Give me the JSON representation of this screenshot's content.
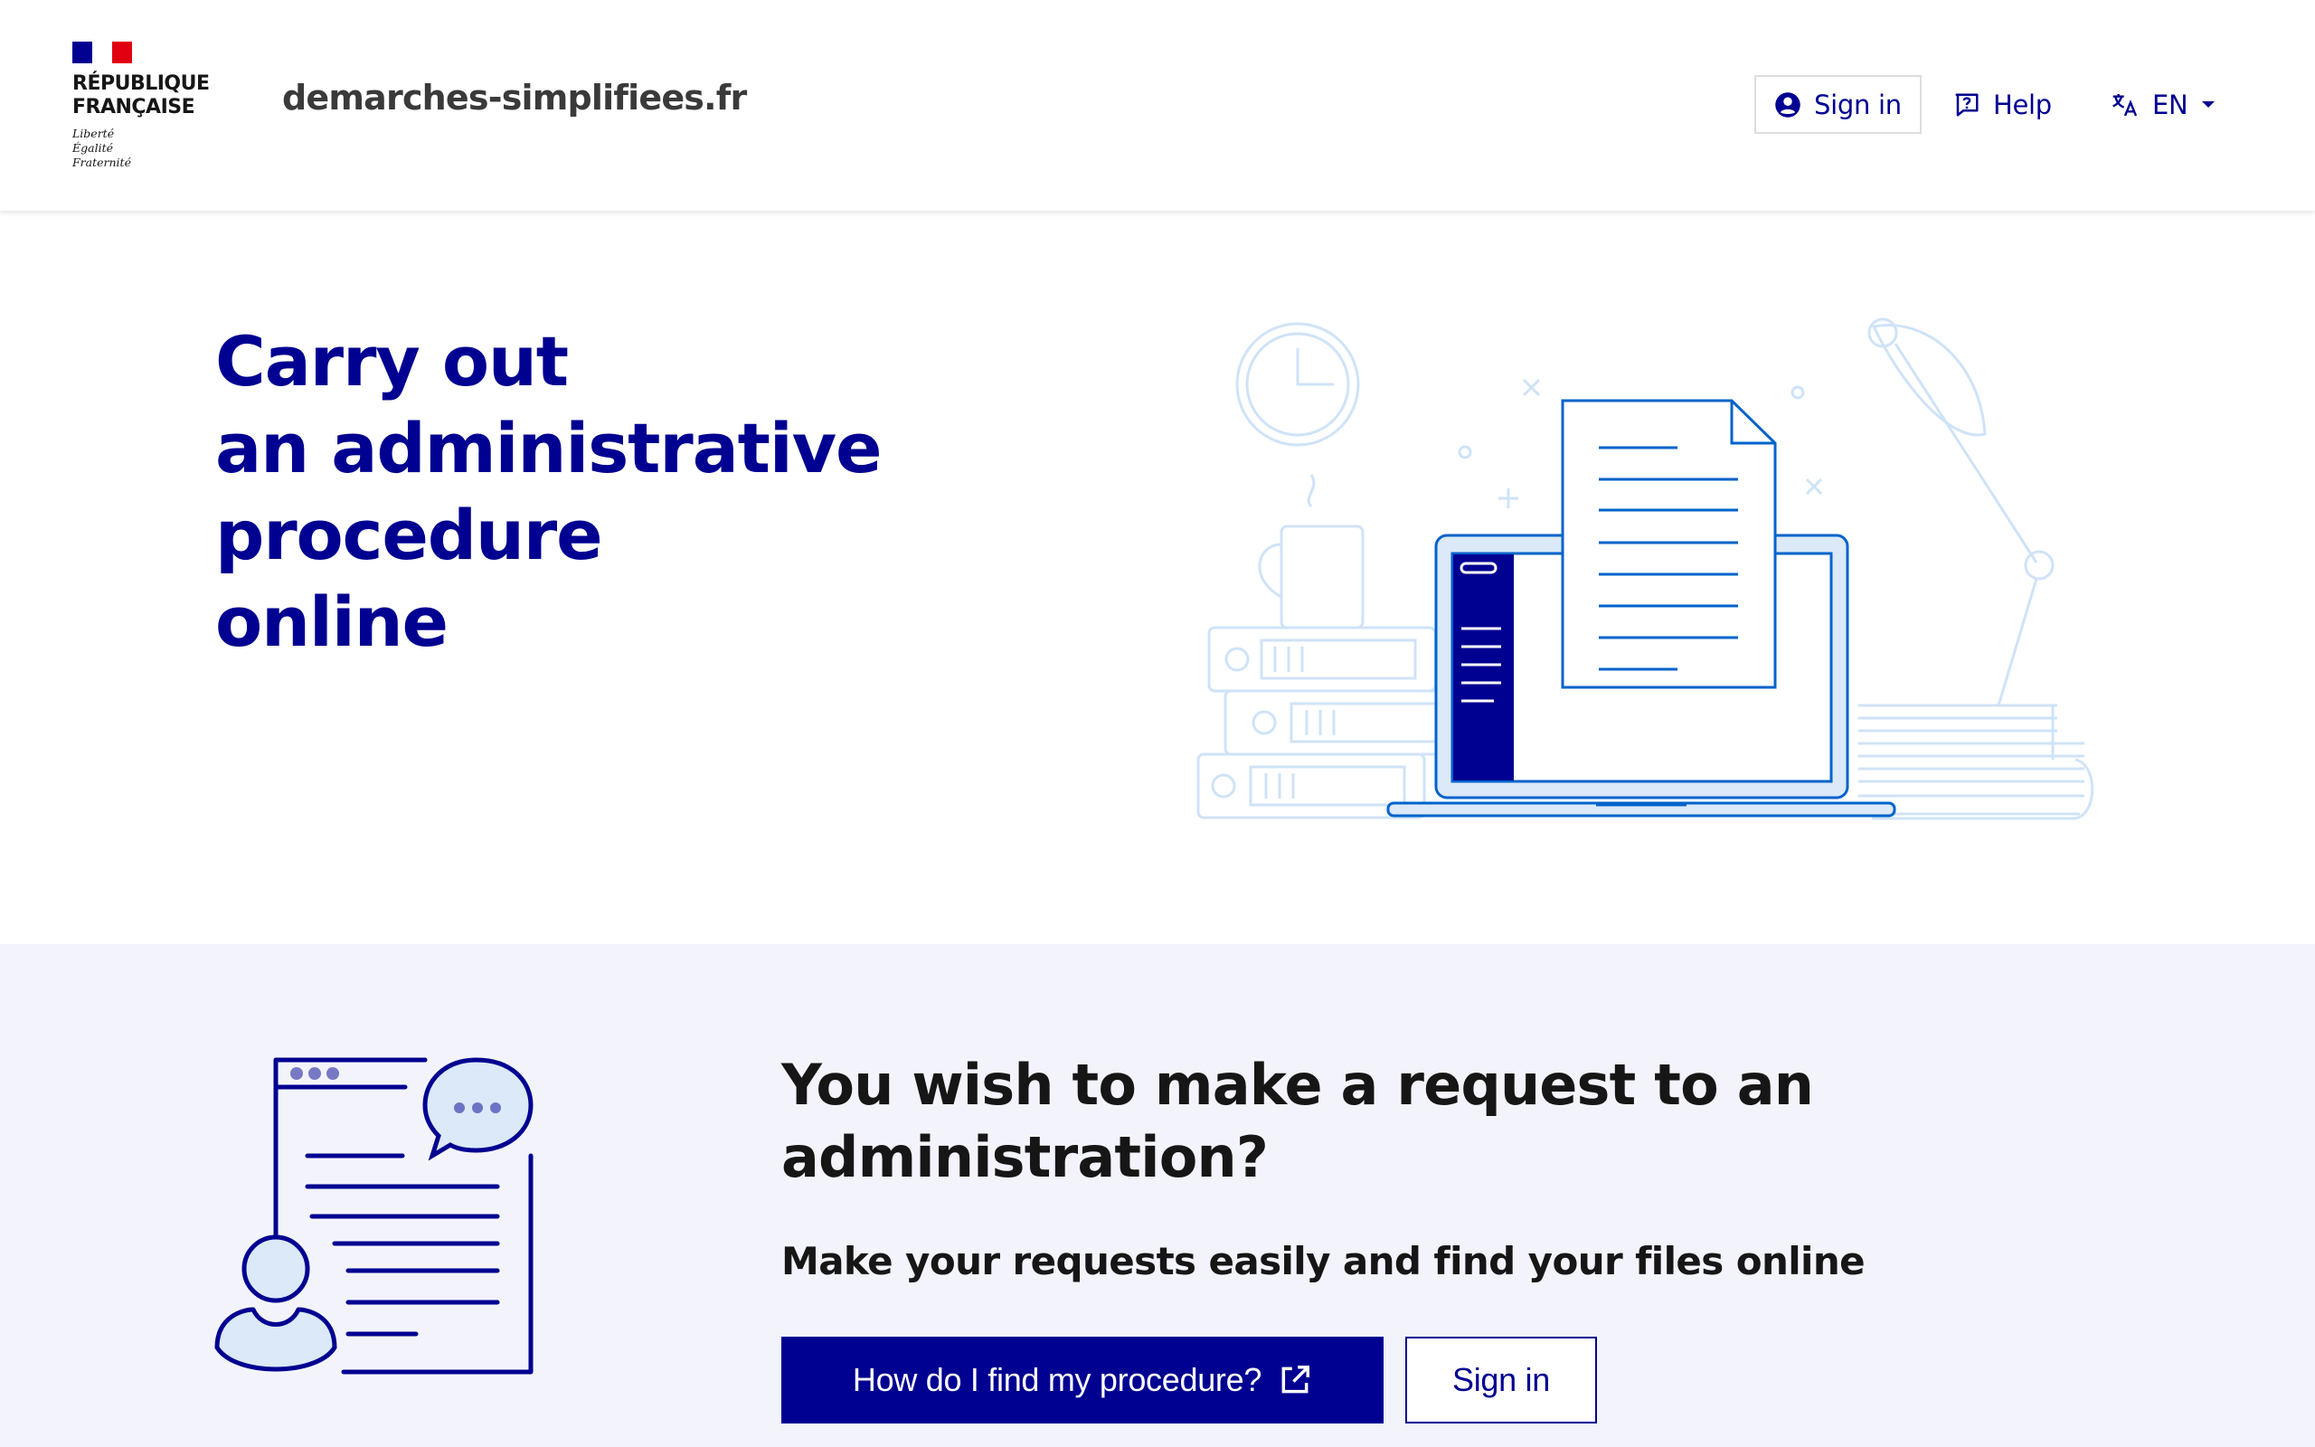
{
  "header": {
    "republic_line1": "RÉPUBLIQUE",
    "republic_line2": "FRANÇAISE",
    "motto": [
      "Liberté",
      "Égalité",
      "Fraternité"
    ],
    "site_name": "demarches-simplifiees.fr",
    "nav": {
      "sign_in": "Sign in",
      "help": "Help",
      "language": "EN"
    }
  },
  "hero": {
    "title_lines": [
      "Carry out",
      "an administrative",
      "procedure",
      "online"
    ]
  },
  "request_section": {
    "title": "You wish to make a request to an administration?",
    "subtitle": "Make your requests easily and find your files online",
    "primary_button": "How do I find my procedure?",
    "secondary_button": "Sign in"
  },
  "colors": {
    "brand_blue": "#000091",
    "flag_red": "#e1000f",
    "section_bg": "#f3f4fb",
    "illustration_light": "#cfe3f7",
    "illustration_mid": "#0063cb"
  },
  "icons": [
    "user-circle-icon",
    "help-question-icon",
    "translate-icon",
    "chevron-down-icon",
    "external-link-icon"
  ]
}
